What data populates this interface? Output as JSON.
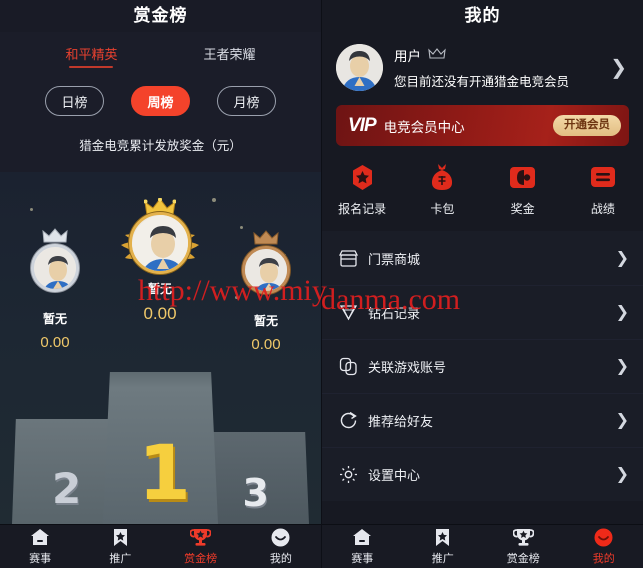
{
  "left_panel": {
    "title": "赏金榜",
    "game_tabs": [
      {
        "label": "和平精英",
        "active": true
      },
      {
        "label": "王者荣耀",
        "active": false
      }
    ],
    "period_pills": [
      {
        "label": "日榜",
        "active": false
      },
      {
        "label": "周榜",
        "active": true
      },
      {
        "label": "月榜",
        "active": false
      }
    ],
    "subtitle": "猎金电竞累计发放奖金（元）",
    "winners": [
      {
        "rank": "2",
        "name": "暂无",
        "score": "0.00",
        "medal_color": "#cdd3db"
      },
      {
        "rank": "1",
        "name": "暂无",
        "score": "0.00",
        "medal_color": "#e3b14c"
      },
      {
        "rank": "3",
        "name": "暂无",
        "score": "0.00",
        "medal_color": "#c08a54"
      }
    ],
    "podium_numbers": {
      "first": "1",
      "second": "2",
      "third": "3"
    }
  },
  "right_panel": {
    "title": "我的",
    "profile": {
      "username": "用户",
      "crown_icon": "crown-icon",
      "subtitle": "您目前还没有开通猎金电竞会员",
      "chevron_icon": "chevron-right-icon"
    },
    "vip_banner": {
      "logo": "VIP",
      "text": "电竞会员中心",
      "button_label": "开通会员",
      "bg_color": "#8f1a16",
      "button_color": "#e9c894"
    },
    "quick_grid": [
      {
        "label": "报名记录",
        "icon": "badge-star-icon"
      },
      {
        "label": "卡包",
        "icon": "money-bag-icon"
      },
      {
        "label": "奖金",
        "icon": "wallet-icon"
      },
      {
        "label": "战绩",
        "icon": "list-icon"
      }
    ],
    "menu_rows": [
      {
        "label": "门票商城",
        "icon": "shop-icon"
      },
      {
        "label": "钻石记录",
        "icon": "diamond-icon"
      },
      {
        "label": "关联游戏账号",
        "icon": "link-accounts-icon"
      },
      {
        "label": "推荐给好友",
        "icon": "share-refresh-icon"
      },
      {
        "label": "设置中心",
        "icon": "gear-icon"
      }
    ]
  },
  "tabbar_left": [
    {
      "label": "赛事",
      "icon": "home-icon",
      "active": false
    },
    {
      "label": "推广",
      "icon": "bookmark-star-icon",
      "active": false
    },
    {
      "label": "赏金榜",
      "icon": "trophy-icon",
      "active": true
    },
    {
      "label": "我的",
      "icon": "smiley-icon",
      "active": false
    }
  ],
  "tabbar_right": [
    {
      "label": "赛事",
      "icon": "home-icon",
      "active": false
    },
    {
      "label": "推广",
      "icon": "bookmark-star-icon",
      "active": false
    },
    {
      "label": "赏金榜",
      "icon": "trophy-icon",
      "active": false
    },
    {
      "label": "我的",
      "icon": "smiley-icon",
      "active": true
    }
  ],
  "watermark": {
    "part1": "http://www.miy",
    "part2": "danma.com"
  },
  "colors": {
    "accent_red": "#ef3b2a",
    "pill_active": "#f4432b",
    "gold": "#f0c96a",
    "panel_bg": "#1b1d29",
    "row_bg": "#1a1d27"
  }
}
